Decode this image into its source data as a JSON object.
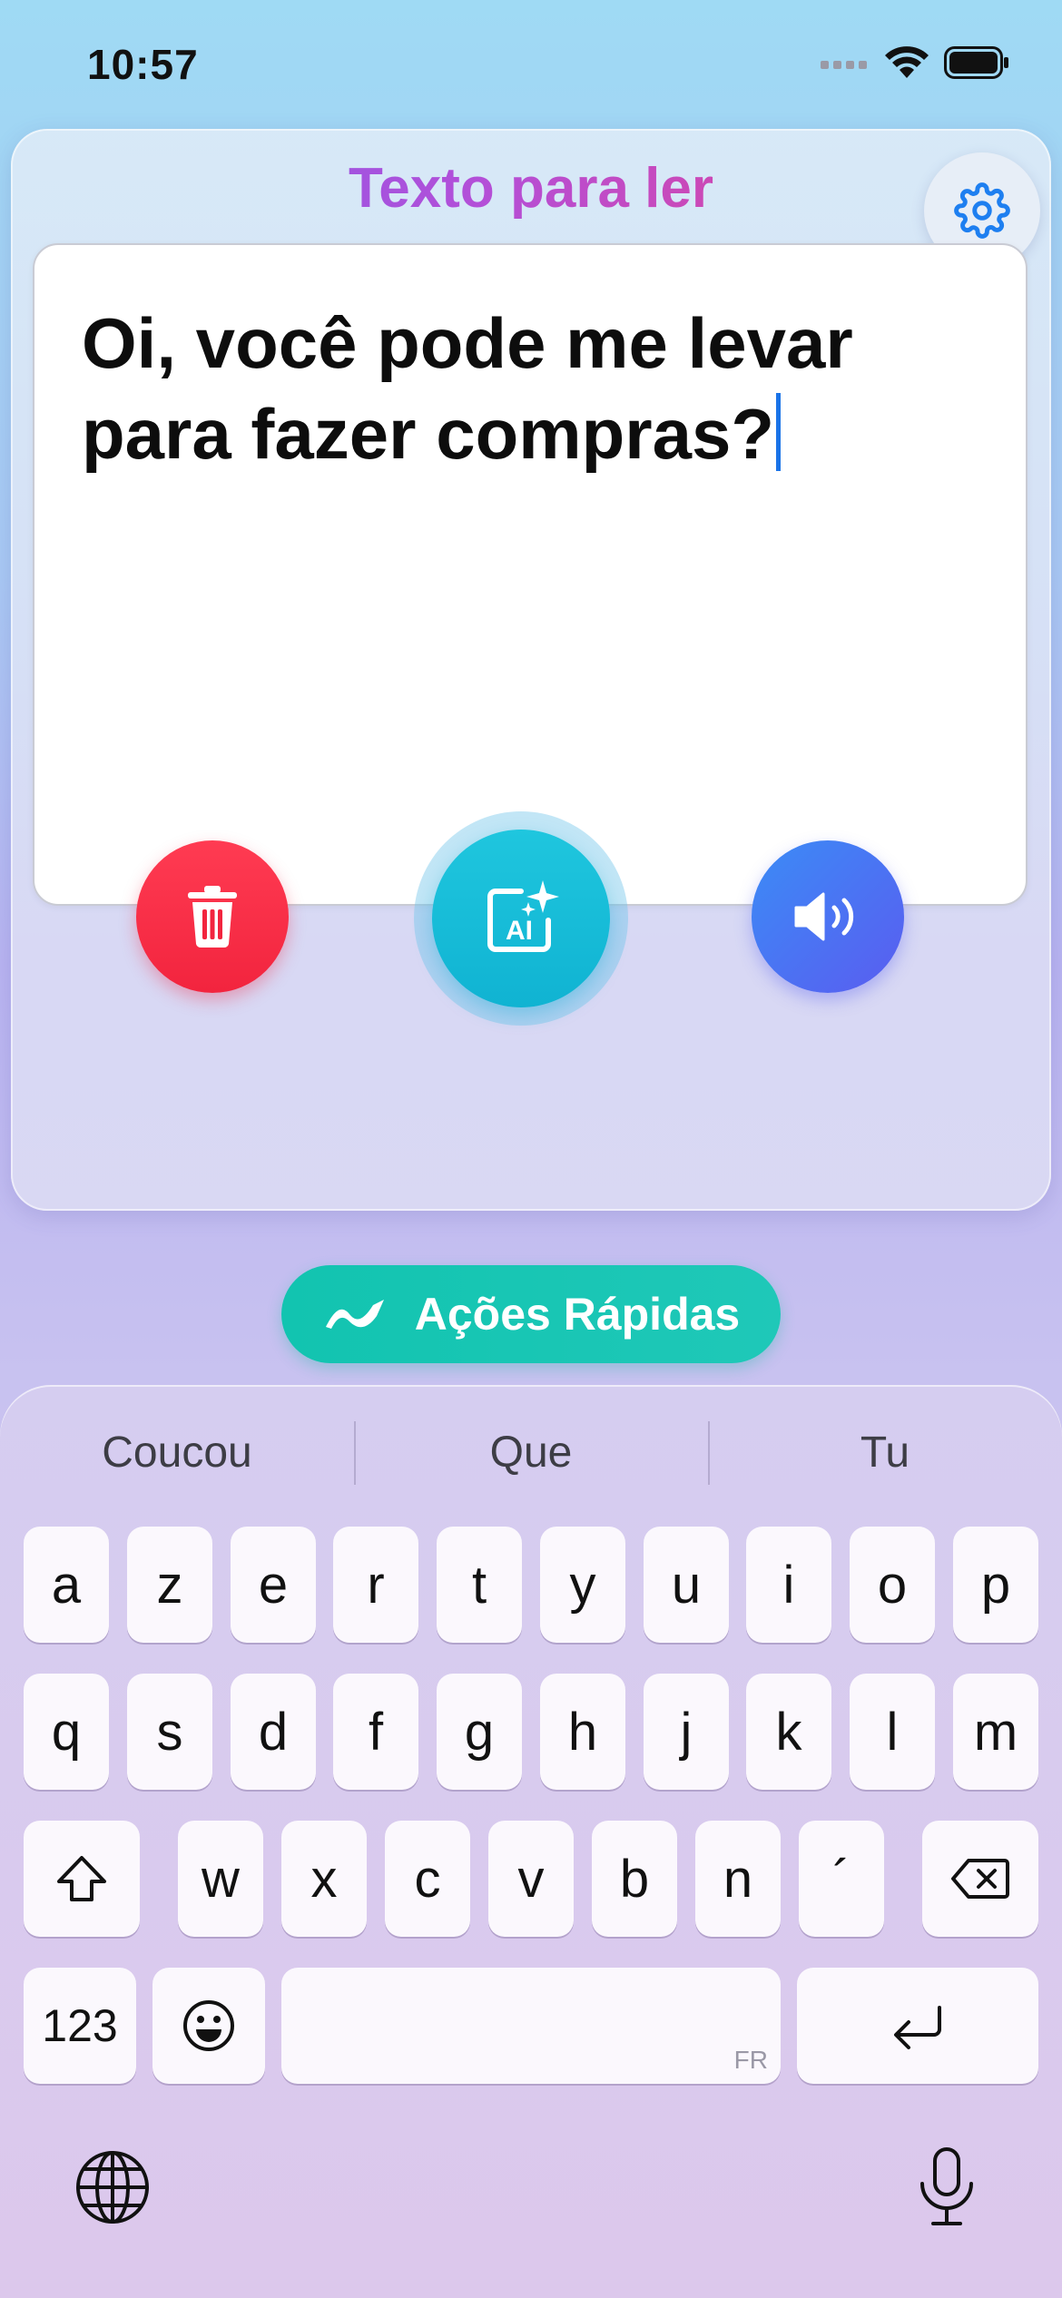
{
  "status": {
    "time": "10:57"
  },
  "card": {
    "title": "Texto para ler",
    "text": "Oi, você pode me levar para fazer compras?"
  },
  "buttons": {
    "delete": "trash-icon",
    "ai": "ai-sparkle-icon",
    "speak": "speaker-icon"
  },
  "quick_actions": {
    "label": "Ações Rápidas"
  },
  "keyboard": {
    "suggestions": [
      "Coucou",
      "Que",
      "Tu"
    ],
    "row1": [
      "a",
      "z",
      "e",
      "r",
      "t",
      "y",
      "u",
      "i",
      "o",
      "p"
    ],
    "row2": [
      "q",
      "s",
      "d",
      "f",
      "g",
      "h",
      "j",
      "k",
      "l",
      "m"
    ],
    "row3": [
      "w",
      "x",
      "c",
      "v",
      "b",
      "n",
      "´"
    ],
    "numbers_label": "123",
    "space_language": "FR"
  },
  "colors": {
    "title_gradient": [
      "#7a5ff0",
      "#ee3f86"
    ],
    "delete": "#f2243e",
    "ai": "#10b3d2",
    "speak": "#3b8cf6",
    "quick_actions": "#12c4b0",
    "caret": "#1a73e8"
  }
}
